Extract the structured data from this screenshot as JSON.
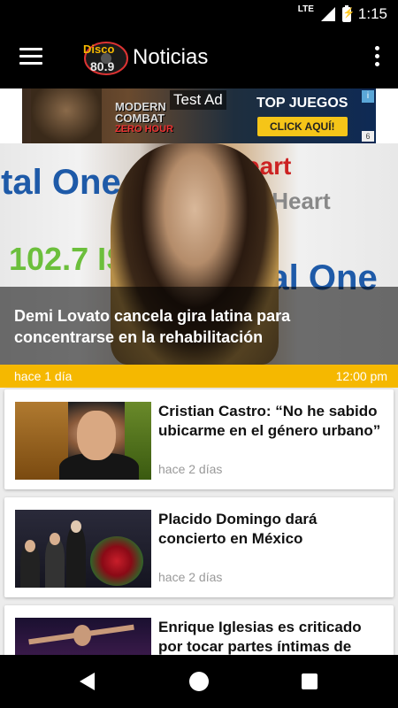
{
  "status_bar": {
    "network": "LTE",
    "time": "1:15"
  },
  "app_bar": {
    "title": "Noticias",
    "logo_icon": "disco-logo-icon"
  },
  "ad": {
    "label": "Test Ad",
    "game_line1": "MODERN",
    "game_line2": "COMBAT",
    "game_line3": "ZERO HOUR",
    "promo": "TOP JUEGOS",
    "cta": "CLICK AQUÍ!",
    "badge": "i",
    "close": "6"
  },
  "featured": {
    "title": "Demi Lovato cancela gira latina para concentrarse en la rehabilitación",
    "time_ago": "hace 1 día",
    "time": "12:00 pm",
    "background_words": [
      "ital One",
      "iHeart",
      "102.7 IS FM",
      "ital One",
      "iHeart"
    ]
  },
  "articles": [
    {
      "title": "Cristian Castro: “No he sabido ubicarme en el género urbano”",
      "time_ago": "hace 2 días"
    },
    {
      "title": "Placido Domingo dará concierto en México",
      "time_ago": "hace 2 días"
    },
    {
      "title": "Enrique Iglesias es criticado por tocar partes íntimas de",
      "time_ago": ""
    }
  ],
  "colors": {
    "accent": "#f5b800",
    "bar": "#000000",
    "ad_cta": "#f5c518"
  }
}
